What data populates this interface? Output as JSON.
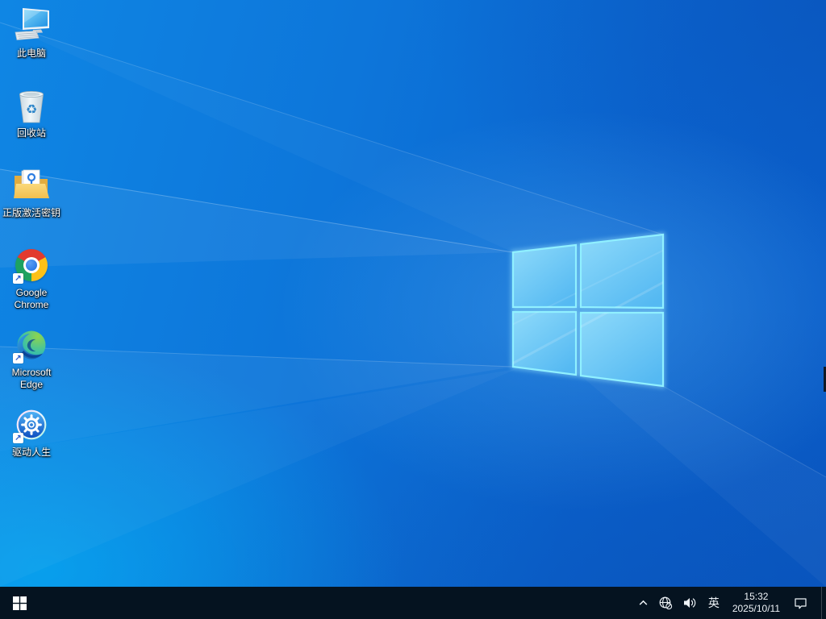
{
  "desktop": {
    "icons": [
      {
        "name": "this-pc",
        "label": "此电脑"
      },
      {
        "name": "recycle-bin",
        "label": "回收站"
      },
      {
        "name": "activation-key-folder",
        "label": "正版激活密钥"
      },
      {
        "name": "google-chrome",
        "label": "Google\nChrome"
      },
      {
        "name": "microsoft-edge",
        "label": "Microsoft\nEdge"
      },
      {
        "name": "driver-life",
        "label": "驱动人生"
      }
    ],
    "wallpaper": "windows-10-light-logo"
  },
  "taskbar": {
    "start_icon": "windows-logo",
    "tray": {
      "hidden_icons_icon": "chevron-up",
      "network_icon": "globe-no-internet",
      "volume_icon": "speaker-sound",
      "ime_label": "英",
      "clock": {
        "time": "15:32",
        "date": "2025/10/11"
      },
      "action_center_icon": "notification-bubble"
    }
  },
  "colors": {
    "taskbar_bg": "#051320",
    "wallpaper_primary": "#0d76da",
    "wallpaper_cyan_glow": "#00cdff",
    "logo_pane_fill": "#6cc6f4",
    "logo_stroke": "#90f0ff"
  }
}
